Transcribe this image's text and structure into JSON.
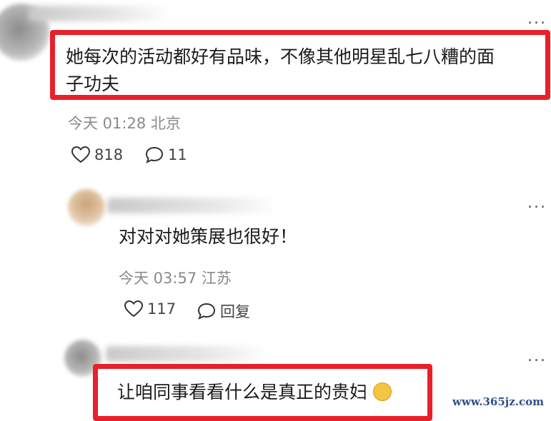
{
  "comments": [
    {
      "text": "她每次的活动都好有品味，不像其他明星乱七八糟的面子功夫",
      "line1": "她每次的活动都好有品味，不像其他明星乱七八糟的面",
      "line2": "子功夫",
      "time": "今天 01:28 北京",
      "likes": "818",
      "replies": "11",
      "more": "..."
    },
    {
      "text": "对对对她策展也很好！",
      "time": "今天 03:57 江苏",
      "likes": "117",
      "replies": "回复",
      "more": "..."
    },
    {
      "text": "让咱同事看看什么是真正的贵妇",
      "more": "..."
    }
  ],
  "watermark": "www.365jz.com",
  "colors": {
    "highlight": "#e8202a",
    "meta": "#8a8a8a"
  },
  "icons": {
    "like": "heart-outline-icon",
    "reply": "speech-bubble-icon",
    "emoji": "smiling-face-emoji-icon"
  }
}
